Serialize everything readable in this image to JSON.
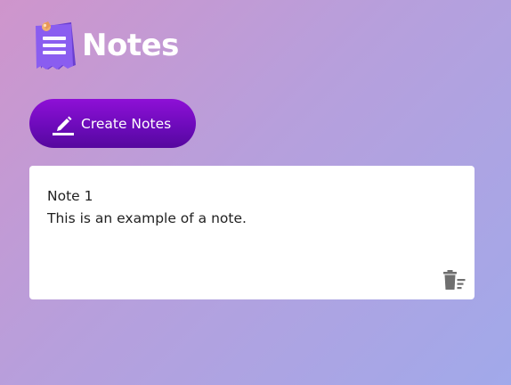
{
  "app": {
    "title": "Notes",
    "icon": "notepad-icon"
  },
  "toolbar": {
    "create_label": "Create Notes",
    "create_icon": "pencil-icon"
  },
  "notes": [
    {
      "lines": [
        "Note 1",
        "This is an example of a note."
      ],
      "delete_icon": "trash-icon"
    }
  ],
  "colors": {
    "button_start": "#8e10d6",
    "button_end": "#56089e",
    "background_start": "#cf95cc",
    "background_end": "#a1a9ea",
    "card": "#ffffff"
  }
}
